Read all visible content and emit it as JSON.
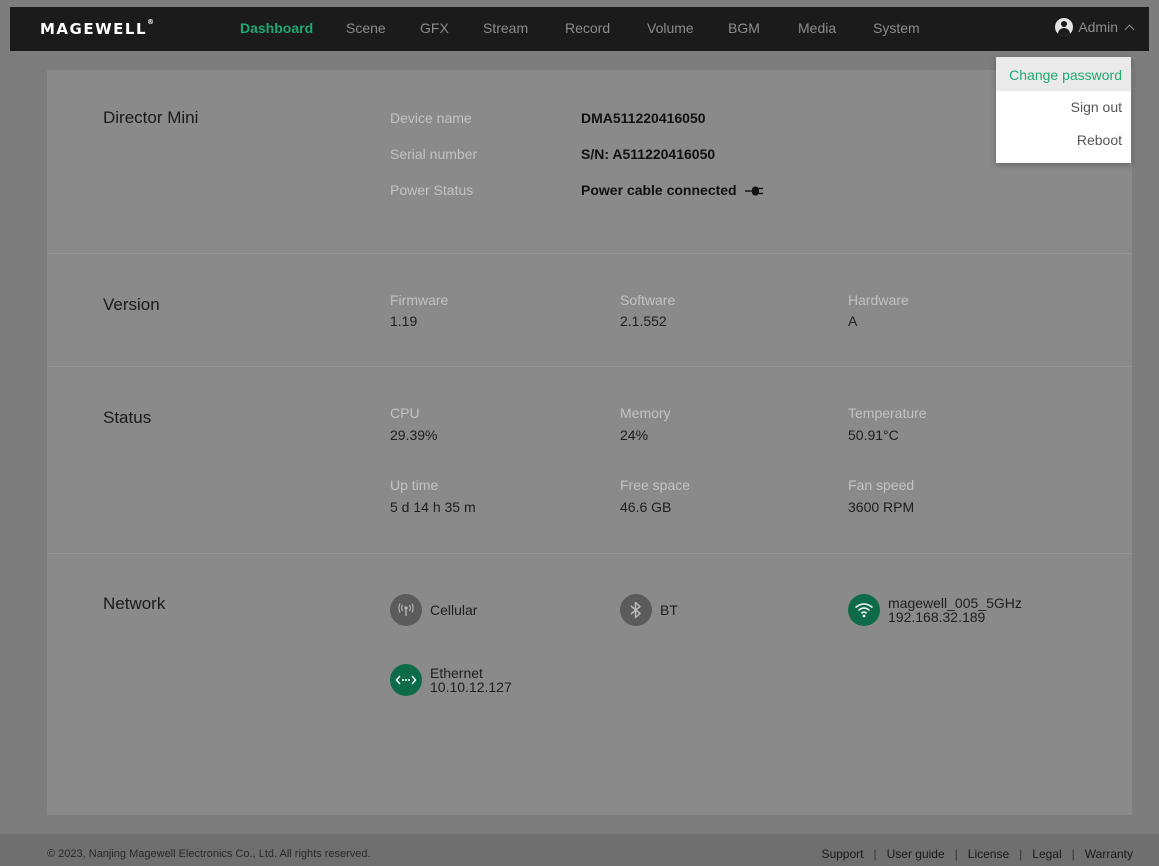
{
  "header": {
    "logo": "MAGEWELL",
    "logo_mark": "®",
    "nav": [
      {
        "label": "Dashboard",
        "active": true
      },
      {
        "label": "Scene"
      },
      {
        "label": "GFX"
      },
      {
        "label": "Stream"
      },
      {
        "label": "Record"
      },
      {
        "label": "Volume"
      },
      {
        "label": "BGM"
      },
      {
        "label": "Media"
      },
      {
        "label": "System"
      }
    ],
    "user": "Admin"
  },
  "user_menu": {
    "items": [
      "Change password",
      "Sign out",
      "Reboot"
    ]
  },
  "device": {
    "title": "Director Mini",
    "device_name_label": "Device name",
    "device_name": "DMA511220416050",
    "serial_label": "Serial number",
    "serial": "S/N: A511220416050",
    "power_label": "Power Status",
    "power": "Power cable connected"
  },
  "version": {
    "title": "Version",
    "firmware_label": "Firmware",
    "firmware": "1.19",
    "software_label": "Software",
    "software": "2.1.552",
    "hardware_label": "Hardware",
    "hardware": "A"
  },
  "status": {
    "title": "Status",
    "cpu_label": "CPU",
    "cpu": "29.39%",
    "memory_label": "Memory",
    "memory": "24%",
    "temperature_label": "Temperature",
    "temperature": "50.91°C",
    "uptime_label": "Up time",
    "uptime": "5 d 14 h 35 m",
    "free_space_label": "Free space",
    "free_space": "46.6 GB",
    "fan_label": "Fan speed",
    "fan": "3600 RPM"
  },
  "network": {
    "title": "Network",
    "cellular": "Cellular",
    "bt": "BT",
    "wifi_name": "magewell_005_5GHz",
    "wifi_ip": "192.168.32.189",
    "ethernet_name": "Ethernet",
    "ethernet_ip": "10.10.12.127"
  },
  "footer": {
    "copyright": "© 2023, Nanjing Magewell Electronics Co., Ltd. All rights reserved.",
    "links": [
      "Support",
      "User guide",
      "License",
      "Legal",
      "Warranty"
    ]
  },
  "colors": {
    "accent": "#1fa870",
    "navbar": "#1b1b1b",
    "overlay_card": "#8a8a8a",
    "network_active": "#0e6b4a"
  }
}
